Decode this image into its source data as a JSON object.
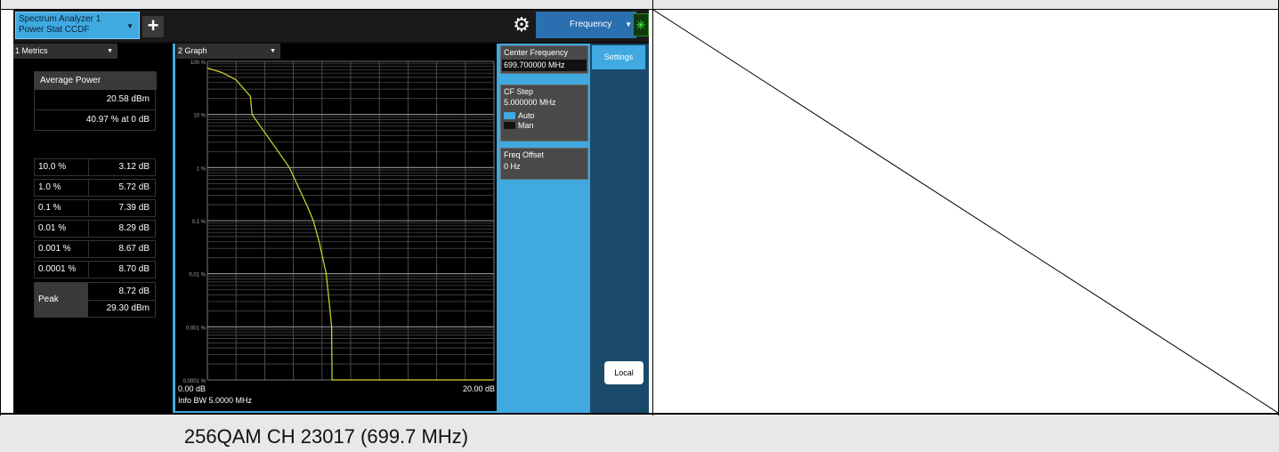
{
  "caption": "256QAM CH 23017 (699.7 MHz)",
  "title_bar": {
    "tab_line1": "Spectrum Analyzer 1",
    "tab_line2": "Power Stat CCDF",
    "add_label": "+",
    "menu_label": "Frequency"
  },
  "metrics": {
    "header": "1 Metrics",
    "average_power": {
      "label": "Average Power",
      "value_dbm": "20.58 dBm",
      "value_pct": "40.97 % at 0 dB"
    },
    "rows": [
      {
        "prob": "10.0 %",
        "value": "3.12 dB"
      },
      {
        "prob": "1.0 %",
        "value": "5.72 dB"
      },
      {
        "prob": "0.1 %",
        "value": "7.39 dB"
      },
      {
        "prob": "0.01 %",
        "value": "8.29 dB"
      },
      {
        "prob": "0.001 %",
        "value": "8.67 dB"
      },
      {
        "prob": "0.0001 %",
        "value": "8.70 dB"
      }
    ],
    "peak": {
      "label": "Peak",
      "value_db": "8.72 dB",
      "value_dbm": "29.30 dBm"
    }
  },
  "graph": {
    "header": "2 Graph",
    "x_start": "0.00 dB",
    "x_end": "20.00 dB",
    "info": "Info BW 5.0000 MHz",
    "y_ticks": [
      "100 %",
      "10 %",
      "1 %",
      "0.1 %",
      "0.01 %",
      "0.001 %",
      "0.0001 %"
    ]
  },
  "chart_data": {
    "type": "line",
    "title": "",
    "xlabel": "",
    "ylabel": "",
    "xlim": [
      0,
      20
    ],
    "y_scale": "log",
    "ylim": [
      0.0001,
      100
    ],
    "grid": true,
    "series": [
      {
        "x": [
          0,
          1,
          2,
          3,
          3.12,
          4,
          5,
          5.72,
          6.5,
          7,
          7.39,
          7.8,
          8.29,
          8.5,
          8.67,
          8.7,
          8.72,
          20
        ],
        "y": [
          75,
          62,
          45,
          22,
          10,
          4.6,
          1.9,
          1.0,
          0.35,
          0.18,
          0.1,
          0.04,
          0.01,
          0.003,
          0.001,
          0.0001,
          0.0001,
          0.0001
        ],
        "color": "#d8d830"
      }
    ]
  },
  "sidebar": {
    "center_freq_label": "Center Frequency",
    "center_freq_value": "699.700000 MHz",
    "cf_step_label": "CF Step",
    "cf_step_value": "5.000000 MHz",
    "auto_label": "Auto",
    "man_label": "Man",
    "freq_offset_label": "Freq Offset",
    "freq_offset_value": "0 Hz",
    "settings_label": "Settings",
    "local_label": "Local"
  }
}
